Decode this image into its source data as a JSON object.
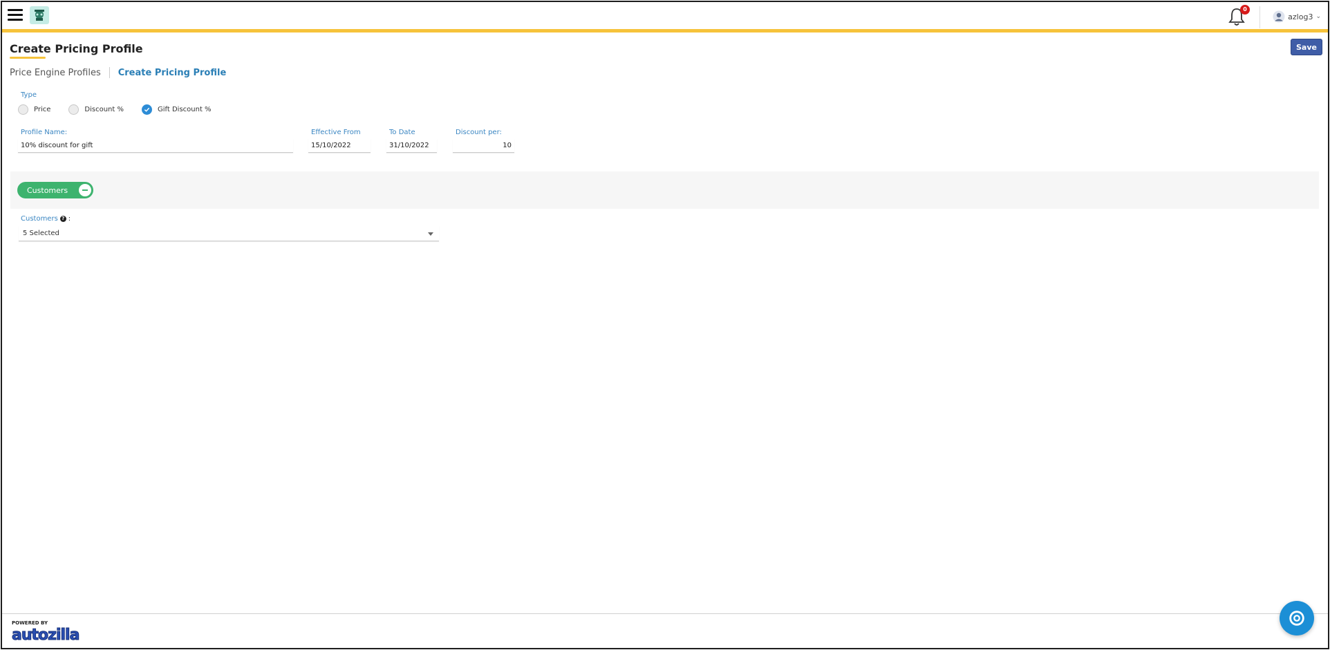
{
  "header": {
    "notification_count": "0",
    "username": "azlog3"
  },
  "page": {
    "title": "Create Pricing Profile",
    "save_label": "Save"
  },
  "breadcrumb": {
    "parent": "Price Engine Profiles",
    "current": "Create Pricing Profile"
  },
  "type": {
    "label": "Type",
    "options": [
      {
        "label": "Price",
        "selected": false
      },
      {
        "label": "Discount %",
        "selected": false
      },
      {
        "label": "Gift Discount %",
        "selected": true
      }
    ]
  },
  "fields": {
    "profile_name": {
      "label": "Profile Name:",
      "value": "10% discount for gift"
    },
    "effective_from": {
      "label": "Effective From",
      "value": "15/10/2022"
    },
    "to_date": {
      "label": "To Date",
      "value": "31/10/2022"
    },
    "discount_per": {
      "label": "Discount per:",
      "value": "10"
    }
  },
  "customers_panel": {
    "pill_label": "Customers",
    "field_label": "Customers",
    "info": "?",
    "colon": ":",
    "selected": "5 Selected"
  },
  "footer": {
    "powered_by": "POWERED BY",
    "brand": "autozilla"
  },
  "colors": {
    "accent_yellow": "#f6c33b",
    "primary_blue": "#3f5da7",
    "link_blue": "#2b7fb6",
    "green": "#3db36e",
    "chat_blue": "#1c8fd6"
  }
}
